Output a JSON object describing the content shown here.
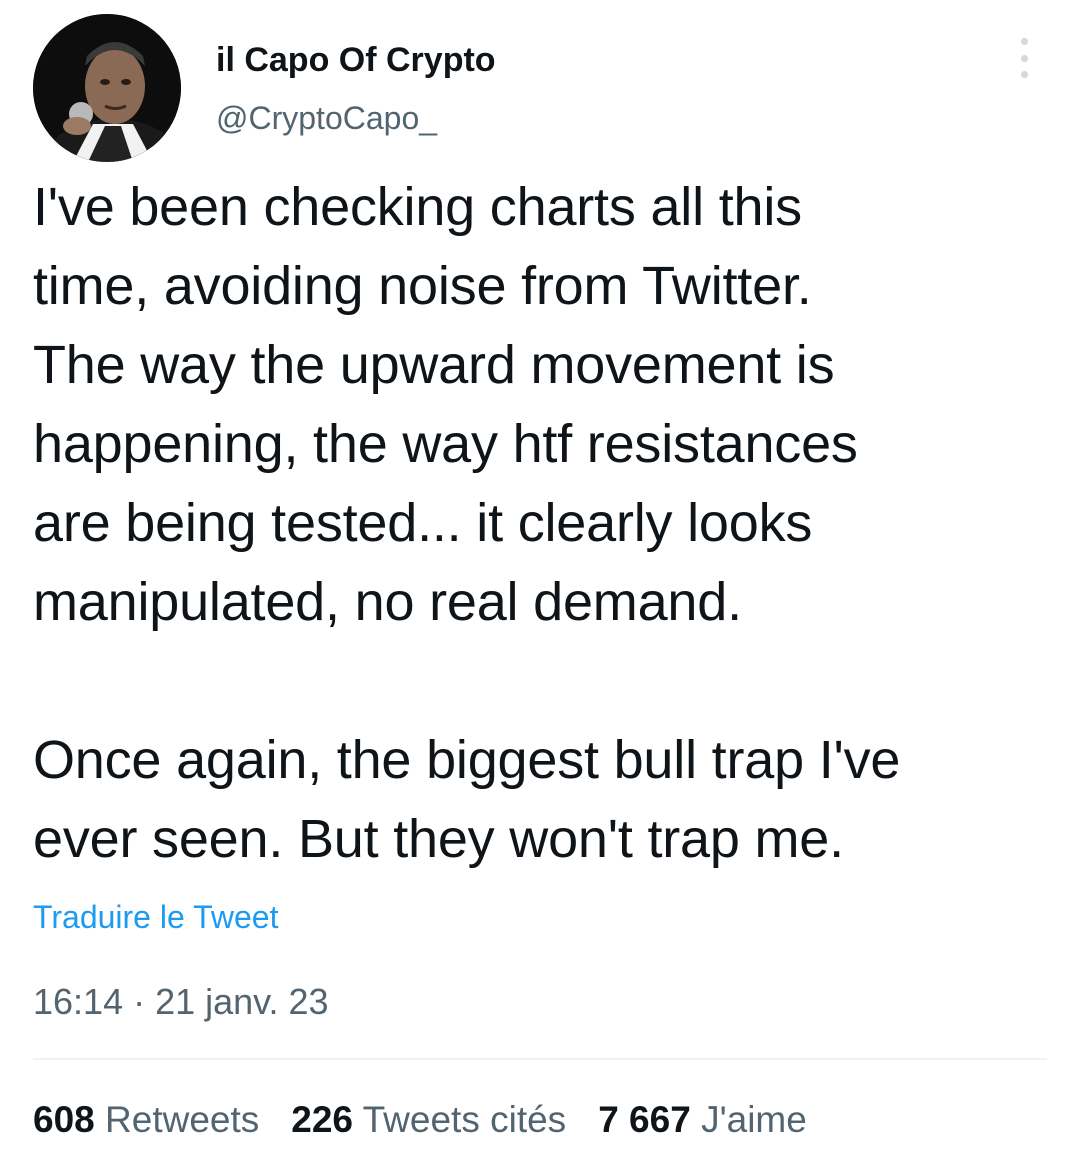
{
  "author": {
    "display_name": "il Capo Of Crypto",
    "handle": "@CryptoCapo_",
    "avatar_icon": "profile-photo"
  },
  "menu": {
    "icon": "more-options-icon"
  },
  "tweet": {
    "paragraph_1": "I've been checking charts all this\ntime, avoiding noise from Twitter.\nThe way the upward movement is\nhappening, the way htf resistances\nare being tested... it clearly looks\nmanipulated, no real demand.",
    "paragraph_2": "Once again, the biggest bull trap I've\never seen. But they won't trap me."
  },
  "translate_label": "Traduire le Tweet",
  "timestamp": "16:14 · 21 janv. 23",
  "stats": {
    "retweets_count": "608",
    "retweets_label": "Retweets",
    "quotes_count": "226",
    "quotes_label": "Tweets cités",
    "likes_count": "7 667",
    "likes_label": "J'aime"
  },
  "colors": {
    "link": "#1d9bf0",
    "secondary_text": "#536471",
    "primary_text": "#0f1419",
    "divider": "#eff3f4"
  }
}
